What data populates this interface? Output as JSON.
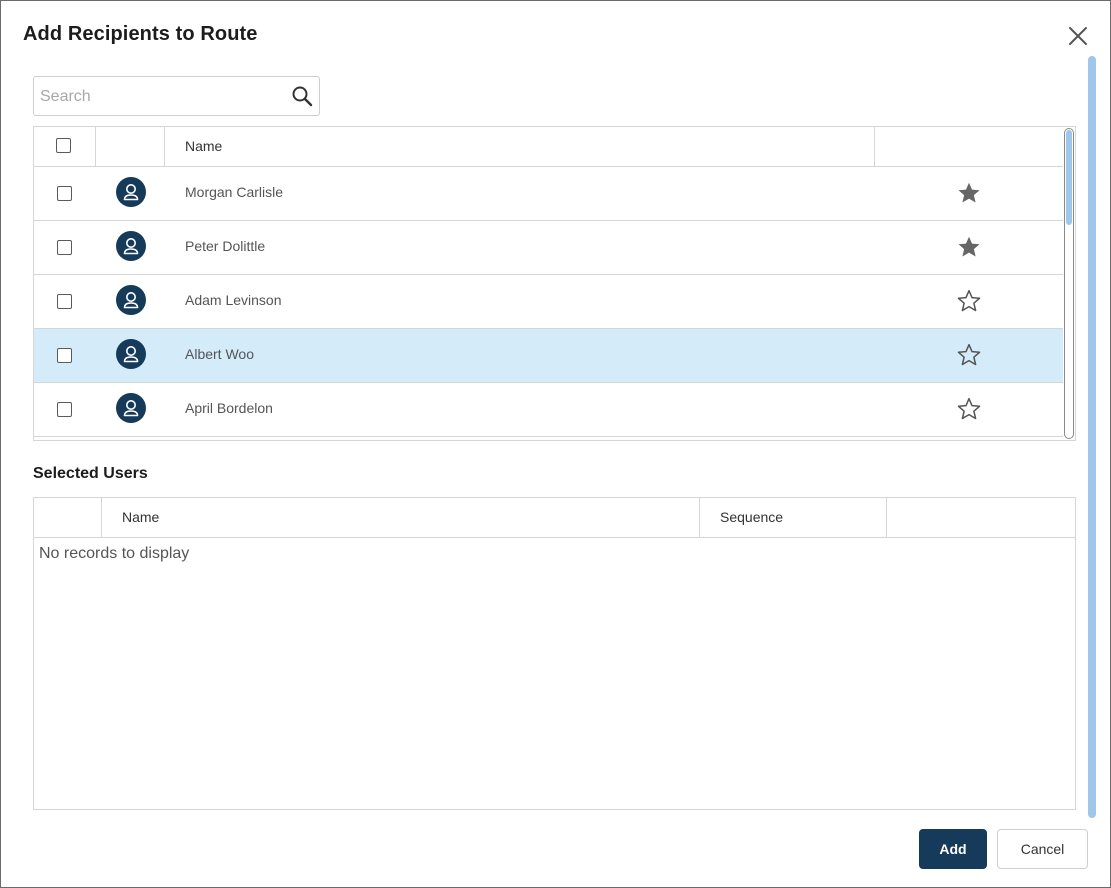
{
  "dialog": {
    "title": "Add Recipients to Route",
    "close_icon": "close-icon"
  },
  "search": {
    "placeholder": "Search",
    "value": "",
    "icon": "search-icon"
  },
  "recipients_grid": {
    "columns": {
      "select": "",
      "avatar": "",
      "name": "Name",
      "favorite": ""
    },
    "rows": [
      {
        "name": "Morgan Carlisle",
        "favorite": true,
        "selected": false
      },
      {
        "name": "Peter Dolittle",
        "favorite": true,
        "selected": false
      },
      {
        "name": "Adam Levinson",
        "favorite": false,
        "selected": false
      },
      {
        "name": "Albert Woo",
        "favorite": false,
        "selected": true
      },
      {
        "name": "April Bordelon",
        "favorite": false,
        "selected": false
      }
    ]
  },
  "selected_users": {
    "title": "Selected Users",
    "columns": {
      "name": "Name",
      "sequence": "Sequence"
    },
    "empty_message": "No records to display"
  },
  "buttons": {
    "add": "Add",
    "cancel": "Cancel"
  },
  "colors": {
    "primary": "#163b5a",
    "row_highlight": "#d4ebfa",
    "scrollbar": "#9fc7ea",
    "star": "#666666"
  }
}
